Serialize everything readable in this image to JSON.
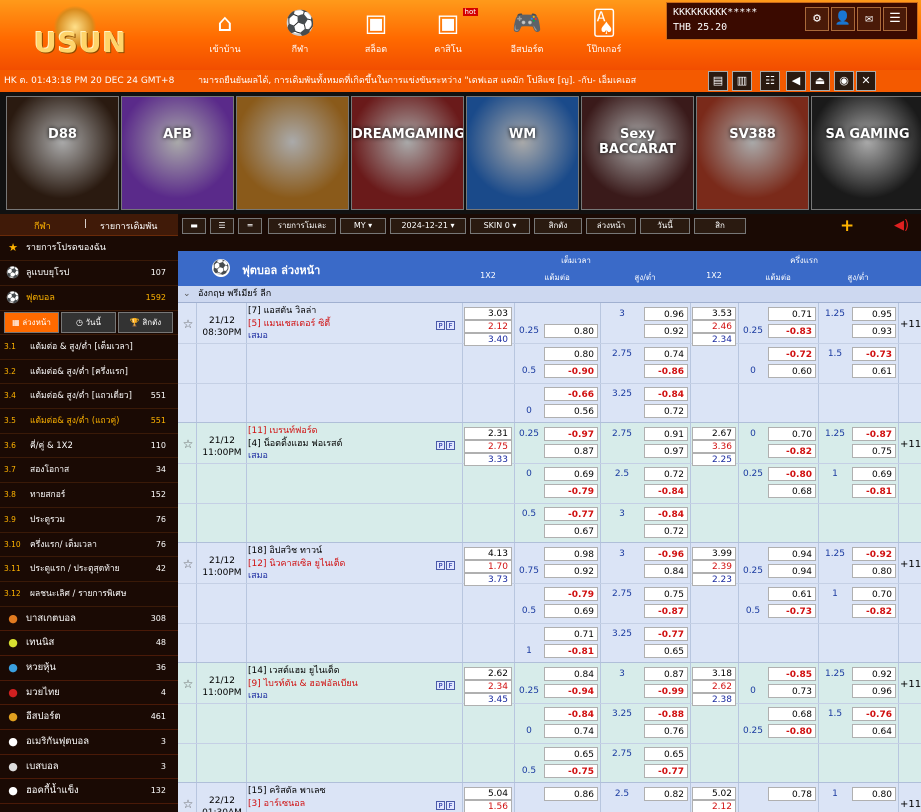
{
  "header": {
    "logo": "USUN",
    "nav": [
      {
        "label": "เข้าบ้าน",
        "icon": "home-icon",
        "glyph": "⌂"
      },
      {
        "label": "กีฬา",
        "icon": "soccer-ball-icon",
        "glyph": "⚽"
      },
      {
        "label": "สล็อต",
        "icon": "slot-icon",
        "glyph": "▣"
      },
      {
        "label": "คาสิโน",
        "icon": "casino-icon",
        "glyph": "▣",
        "badge": "hot"
      },
      {
        "label": "อีสปอร์ต",
        "icon": "gamepad-icon",
        "glyph": "🎮"
      },
      {
        "label": "โป๊กเกอร์",
        "icon": "poker-cards-icon",
        "glyph": "🂡"
      }
    ],
    "account": {
      "username": "KKKKKKKKK*****",
      "balance": "THB 25.20"
    }
  },
  "ticker": {
    "time": "HK ต. 01:43:18 PM 20 DEC 24 GMT+8",
    "message": "ามารถยืนยันผลได้, การเดิมพันทั้งหมดที่เกิดขึ้นในการแข่งขันระหว่าง \"เดฟเอส แคมัก โปลิแซ [ญ]. -กับ- เอ็มเคเอส"
  },
  "games": [
    "D88",
    "AFB",
    "",
    "DREAMGAMING",
    "WM",
    "Sexy BACCARAT",
    "SV388",
    "SA GAMING"
  ],
  "sidebar": {
    "tabs": [
      "กีฬา",
      "รายการเดิมพัน"
    ],
    "top": [
      {
        "label": "รายการโปรดของฉัน",
        "icon": "star-icon",
        "glyph": "★",
        "count": ""
      },
      {
        "label": "ลูแบบยุโรป",
        "icon": "soccer-ball-icon",
        "glyph": "⚽",
        "count": "107"
      },
      {
        "label": "ฟุตบอล",
        "icon": "soccer-ball-icon",
        "glyph": "⚽",
        "count": "1592",
        "sel": true
      }
    ],
    "subtabs": [
      {
        "label": "ล่วงหน้า",
        "icon": "calendar-icon",
        "on": true
      },
      {
        "label": "วันนี้",
        "icon": "clock-icon",
        "on": false
      },
      {
        "label": "สิกตัง",
        "icon": "trophy-icon",
        "on": false
      }
    ],
    "leagues": [
      {
        "num": "3.1",
        "label": "แต้มต่อ & สูง/ต่ำ [เต็มเวลา]",
        "count": ""
      },
      {
        "num": "3.2",
        "label": "แต้มต่อ& สูง/ต่ำ [ครึ่งแรก]",
        "count": ""
      },
      {
        "num": "3.4",
        "label": "แต้มต่อ& สูง/ต่ำ [แถวเดี่ยว]",
        "count": "551"
      },
      {
        "num": "3.5",
        "label": "แต้มต่อ& สูง/ต่ำ (แถวคู่)",
        "count": "551",
        "sel": true
      },
      {
        "num": "3.6",
        "label": "คี่/คู่ & 1X2",
        "count": "110"
      },
      {
        "num": "3.7",
        "label": "สองโอกาส",
        "count": "34"
      },
      {
        "num": "3.8",
        "label": "ทายสกอร์",
        "count": "152"
      },
      {
        "num": "3.9",
        "label": "ประตูรวม",
        "count": "76"
      },
      {
        "num": "3.10",
        "label": "ครึ่งแรก/ เต็มเวลา",
        "count": "76"
      },
      {
        "num": "3.11",
        "label": "ประตูแรก / ประตูสุดท้าย",
        "count": "42"
      },
      {
        "num": "3.12",
        "label": "ผลชนะเลิศ / รายการพิเศษ",
        "count": ""
      }
    ],
    "sports": [
      {
        "label": "บาสเกตบอล",
        "icon": "basketball-icon",
        "glyph": "●",
        "color": "#e07a20",
        "count": "308"
      },
      {
        "label": "เทนนิส",
        "icon": "tennis-icon",
        "glyph": "●",
        "color": "#d8e030",
        "count": "48"
      },
      {
        "label": "หวยหุ้น",
        "icon": "lottery-icon",
        "glyph": "●",
        "color": "#3aa0e0",
        "count": "36"
      },
      {
        "label": "มวยไทย",
        "icon": "boxing-icon",
        "glyph": "●",
        "color": "#d02020",
        "count": "4"
      },
      {
        "label": "อีสปอร์ต",
        "icon": "esports-icon",
        "glyph": "●",
        "color": "#e0a020",
        "count": "461"
      },
      {
        "label": "อเมริกันฟุตบอล",
        "icon": "american-football-icon",
        "glyph": "●",
        "color": "#ffffff",
        "count": "3"
      },
      {
        "label": "เบสบอล",
        "icon": "baseball-icon",
        "glyph": "●",
        "color": "#dddddd",
        "count": "3"
      },
      {
        "label": "ฮอคกี้น้ำแข็ง",
        "icon": "hockey-icon",
        "glyph": "●",
        "color": "#ffffff",
        "count": "132"
      }
    ]
  },
  "toolbar": {
    "list_btn": "รายการโมเละ",
    "odds_type": "MY",
    "date": "2024-12-21",
    "skin": "SKIN 0",
    "btn_live": "สิกตัง",
    "btn_early": "ล่วงหน้า",
    "btn_today": "วันนี้",
    "btn_more": "สิก"
  },
  "table": {
    "title": "ฟุตบอล ล่วงหน้า",
    "ft": "เต็มเวลา",
    "fh": "ครึ่งแรก",
    "col_1x2": "1X2",
    "col_hdp": "แต้มต่อ",
    "col_ou": "สูง/ต่ำ",
    "league": "อังกฤษ พรีเมียร์ ลีก"
  },
  "matches": [
    {
      "date": "21/12",
      "time": "08:30PM",
      "home": "[7] แอสตัน วิลล่า",
      "away": "[5] แมนเชสเตอร์ ซิตี้",
      "fav": "away",
      "draw": "เสมอ",
      "x12": [
        "3.03",
        "2.12",
        "3.40"
      ],
      "fh12": [
        "3.53",
        "2.46",
        "2.34"
      ],
      "lines": [
        {
          "hdp": "",
          "hh": "",
          "ha": "-0.90",
          "ou": "3",
          "oh": "0.96",
          "oa": "",
          "fhdp": "",
          "fhh": "0.71",
          "fou": "1.25",
          "foh": "0.95",
          "fhdp2": "0.25",
          "fha": "-0.83",
          "foa": "0.93",
          "hdp2": "0.25",
          "ha2": "0.80",
          "oa2": "0.92"
        },
        {
          "hdp": "",
          "hh": "0.80",
          "ou": "2.75",
          "oh": "0.74",
          "fhh": "-0.72",
          "fou": "1.5",
          "foh": "-0.73",
          "hdp2": "0.5",
          "ha2": "-0.90",
          "oa2": "-0.86",
          "fhdp2": "0",
          "fha": "0.60",
          "foa": "0.61"
        },
        {
          "hh": "-0.66",
          "ou": "3.25",
          "oh": "-0.84",
          "hdp2": "0",
          "ha2": "0.56",
          "oa2": "0.72"
        }
      ]
    },
    {
      "date": "21/12",
      "time": "11:00PM",
      "home": "[11] เบรนท์ฟอร์ด",
      "away": "[4] น็อตติ้งแฮม ฟอเรสต์",
      "fav": "home",
      "draw": "เสมอ",
      "x12": [
        "2.31",
        "2.75",
        "3.33"
      ],
      "fh12": [
        "2.67",
        "3.36",
        "2.25"
      ],
      "lines": [
        {
          "hdp": "0.25",
          "hh": "-0.97",
          "ou": "2.75",
          "oh": "0.91",
          "fhdp": "0",
          "fhh": "0.70",
          "fou": "1.25",
          "foh": "-0.87",
          "ha2": "0.87",
          "oa2": "0.97",
          "fha": "-0.82",
          "foa": "0.75"
        },
        {
          "hdp": "0",
          "hh": "0.69",
          "ou": "2.5",
          "oh": "0.72",
          "fhdp": "0.25",
          "fhh": "-0.80",
          "fou": "1",
          "foh": "0.69",
          "ha2": "-0.79",
          "oa2": "-0.84",
          "fha": "0.68",
          "foa": "-0.81"
        },
        {
          "hdp": "0.5",
          "hh": "-0.77",
          "ou": "3",
          "oh": "-0.84",
          "ha2": "0.67",
          "oa2": "0.72"
        }
      ]
    },
    {
      "date": "21/12",
      "time": "11:00PM",
      "home": "[18] อิปสวิช ทาวน์",
      "away": "[12] นิวคาสเซิล ยูไนเต็ด",
      "fav": "away",
      "draw": "เสมอ",
      "x12": [
        "4.13",
        "1.70",
        "3.73"
      ],
      "fh12": [
        "3.99",
        "2.39",
        "2.23"
      ],
      "lines": [
        {
          "hh": "0.98",
          "ou": "3",
          "oh": "-0.96",
          "fhh": "0.94",
          "fou": "1.25",
          "foh": "-0.92",
          "hdp2": "0.75",
          "ha2": "0.92",
          "oa2": "0.84",
          "fhdp2": "0.25",
          "fha": "0.94",
          "foa": "0.80"
        },
        {
          "hh": "-0.79",
          "ou": "2.75",
          "oh": "0.75",
          "fhh": "0.61",
          "fou": "1",
          "foh": "0.70",
          "hdp2": "0.5",
          "ha2": "0.69",
          "oa2": "-0.87",
          "fhdp2": "0.5",
          "fha": "-0.73",
          "foa": "-0.82"
        },
        {
          "hh": "0.71",
          "ou": "3.25",
          "oh": "-0.77",
          "hdp2": "1",
          "ha2": "-0.81",
          "oa2": "0.65"
        }
      ]
    },
    {
      "date": "21/12",
      "time": "11:00PM",
      "home": "[14] เวสต์แฮม ยูไนเต็ด",
      "away": "[9] ไบรท์ตัน & ฮอฟอัลเบียน",
      "fav": "away",
      "draw": "เสมอ",
      "x12": [
        "2.62",
        "2.34",
        "3.45"
      ],
      "fh12": [
        "3.18",
        "2.62",
        "2.38"
      ],
      "lines": [
        {
          "hh": "0.84",
          "ou": "3",
          "oh": "0.87",
          "fhh": "-0.85",
          "fou": "1.25",
          "foh": "0.92",
          "hdp2": "0.25",
          "ha2": "-0.94",
          "oa2": "-0.99",
          "fhdp2": "0",
          "fha": "0.73",
          "foa": "0.96"
        },
        {
          "hh": "-0.84",
          "ou": "3.25",
          "oh": "-0.88",
          "fhh": "0.68",
          "fou": "1.5",
          "foh": "-0.76",
          "hdp2": "0",
          "ha2": "0.74",
          "oa2": "0.76",
          "fhdp2": "0.25",
          "fha": "-0.80",
          "foa": "0.64"
        },
        {
          "hh": "0.65",
          "ou": "2.75",
          "oh": "0.65",
          "hdp2": "0.5",
          "ha2": "-0.75",
          "oa2": "-0.77"
        }
      ]
    },
    {
      "date": "22/12",
      "time": "01:30AM",
      "home": "[15] คริสตัล พาเลซ",
      "away": "[3] อาร์เซนอล",
      "fav": "away",
      "draw": "",
      "x12": [
        "5.04",
        "1.56",
        ""
      ],
      "fh12": [
        "5.02",
        "2.12",
        ""
      ],
      "lines": [
        {
          "hh": "0.86",
          "ou": "2.5",
          "oh": "0.82",
          "fhh": "0.78",
          "fou": "1",
          "foh": "0.80"
        }
      ]
    }
  ],
  "colors": {
    "accent": "#ff6a00",
    "header_blue": "#3a6ac8",
    "neg": "#d01010"
  }
}
